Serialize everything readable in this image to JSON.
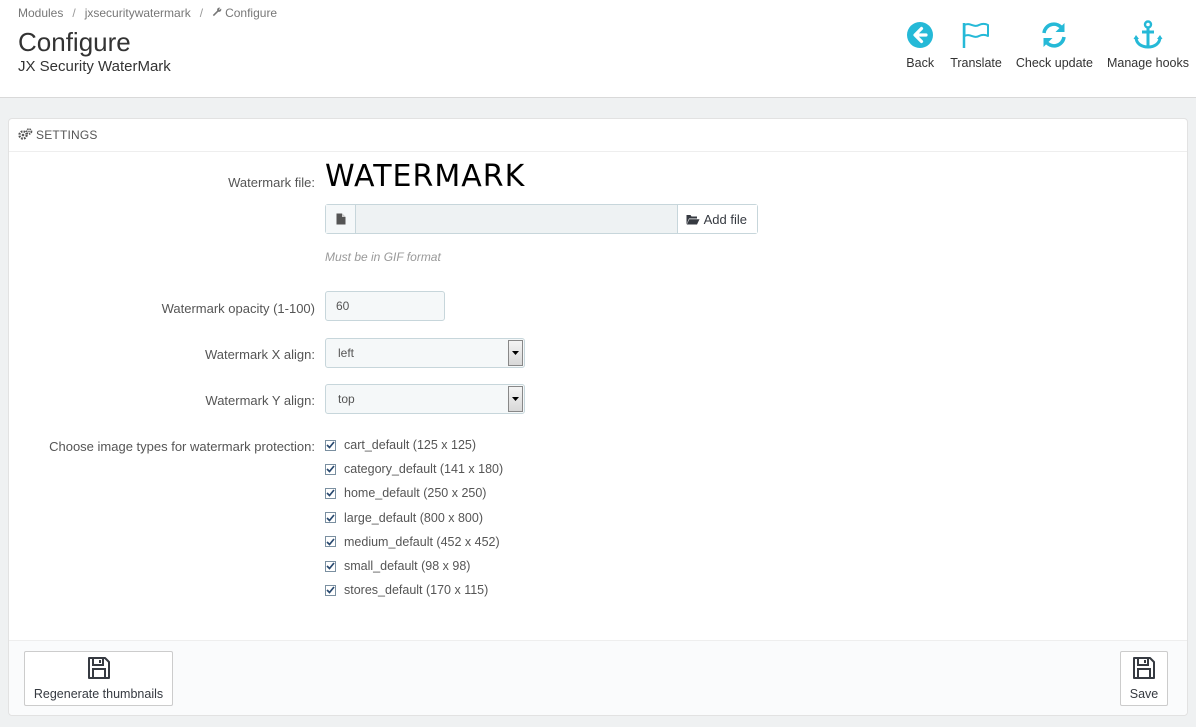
{
  "breadcrumb": {
    "items": [
      "Modules",
      "jxsecuritywatermark",
      "Configure"
    ],
    "separator": "/"
  },
  "page": {
    "title": "Configure",
    "subtitle": "JX Security WaterMark"
  },
  "toolbar": {
    "back": "Back",
    "translate": "Translate",
    "check_update": "Check update",
    "manage_hooks": "Manage hooks",
    "icon_color": "#25b9d7"
  },
  "panel": {
    "heading": "SETTINGS"
  },
  "form": {
    "watermark_file": {
      "label": "Watermark file:",
      "preview_text": "WATERMARK",
      "add_file": "Add file",
      "help": "Must be in GIF format"
    },
    "opacity": {
      "label": "Watermark opacity (1-100)",
      "value": "60"
    },
    "x_align": {
      "label": "Watermark X align:",
      "value": "left"
    },
    "y_align": {
      "label": "Watermark Y align:",
      "value": "top"
    },
    "image_types": {
      "label": "Choose image types for watermark protection:",
      "items": [
        {
          "label": "cart_default (125 x 125)",
          "checked": true
        },
        {
          "label": "category_default (141 x 180)",
          "checked": true
        },
        {
          "label": "home_default (250 x 250)",
          "checked": true
        },
        {
          "label": "large_default (800 x 800)",
          "checked": true
        },
        {
          "label": "medium_default (452 x 452)",
          "checked": true
        },
        {
          "label": "small_default (98 x 98)",
          "checked": true
        },
        {
          "label": "stores_default (170 x 115)",
          "checked": true
        }
      ]
    }
  },
  "footer": {
    "regenerate": "Regenerate thumbnails",
    "save": "Save"
  }
}
